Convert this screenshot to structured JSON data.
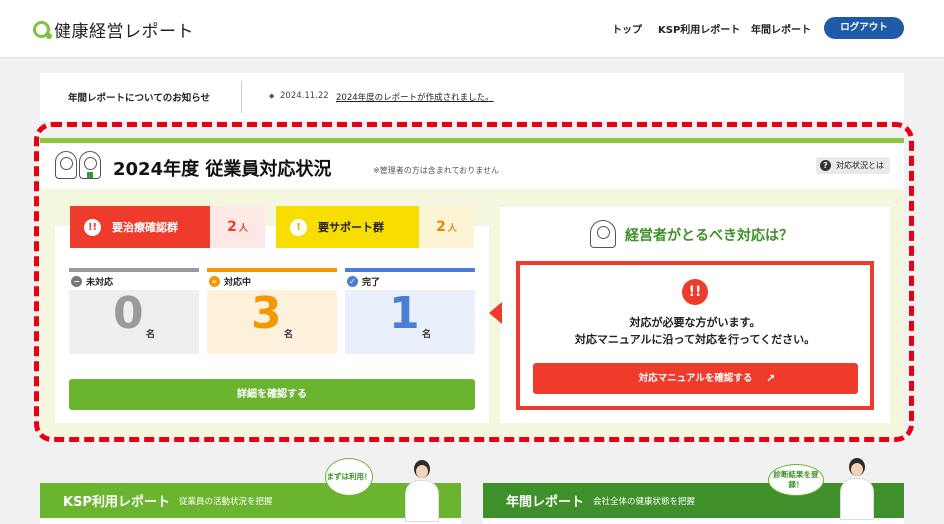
{
  "header": {
    "logo_text": "健康経営レポート",
    "nav": [
      "トップ",
      "KSP利用レポート",
      "年間レポート"
    ],
    "logout_label": "ログアウト"
  },
  "notice": {
    "title": "年間レポートについてのお知らせ",
    "bullet": "◆",
    "date": "2024.11.22",
    "link_text": "2024年度のレポートが作成されました。"
  },
  "status": {
    "title": "2024年度 従業員対応状況",
    "note": "※管理者の方は含まれておりません",
    "help_label": "対応状況とは",
    "categories": [
      {
        "label": "要治療確認群",
        "count": "2",
        "unit": "人"
      },
      {
        "label": "要サポート群",
        "count": "2",
        "unit": "人"
      }
    ],
    "stats": [
      {
        "label": "未対応",
        "value": "0",
        "unit": "名"
      },
      {
        "label": "対応中",
        "value": "3",
        "unit": "名"
      },
      {
        "label": "完了",
        "value": "1",
        "unit": "名"
      }
    ],
    "detail_button": "詳細を確認する"
  },
  "manager": {
    "title": "経営者がとるべき対応は？",
    "message_line1": "対応が必要な方がいます。",
    "message_line2": "対応マニュアルに沿って対応を行ってください。",
    "manual_button": "対応マニュアルを確認する",
    "ext_icon": "↗"
  },
  "panels": [
    {
      "title": "KSP利用レポート",
      "subtitle": "従業員の活動状況を把握",
      "bubble": "まずは利用！"
    },
    {
      "title": "年間レポート",
      "subtitle": "会社全体の健康状態を把握",
      "bubble": "診断結果を登録！"
    }
  ],
  "colors": {
    "brand_green": "#6bb42f",
    "alert_red": "#ef3b2c",
    "warning_yellow": "#f7dd00",
    "primary_blue": "#1f5aa6"
  }
}
